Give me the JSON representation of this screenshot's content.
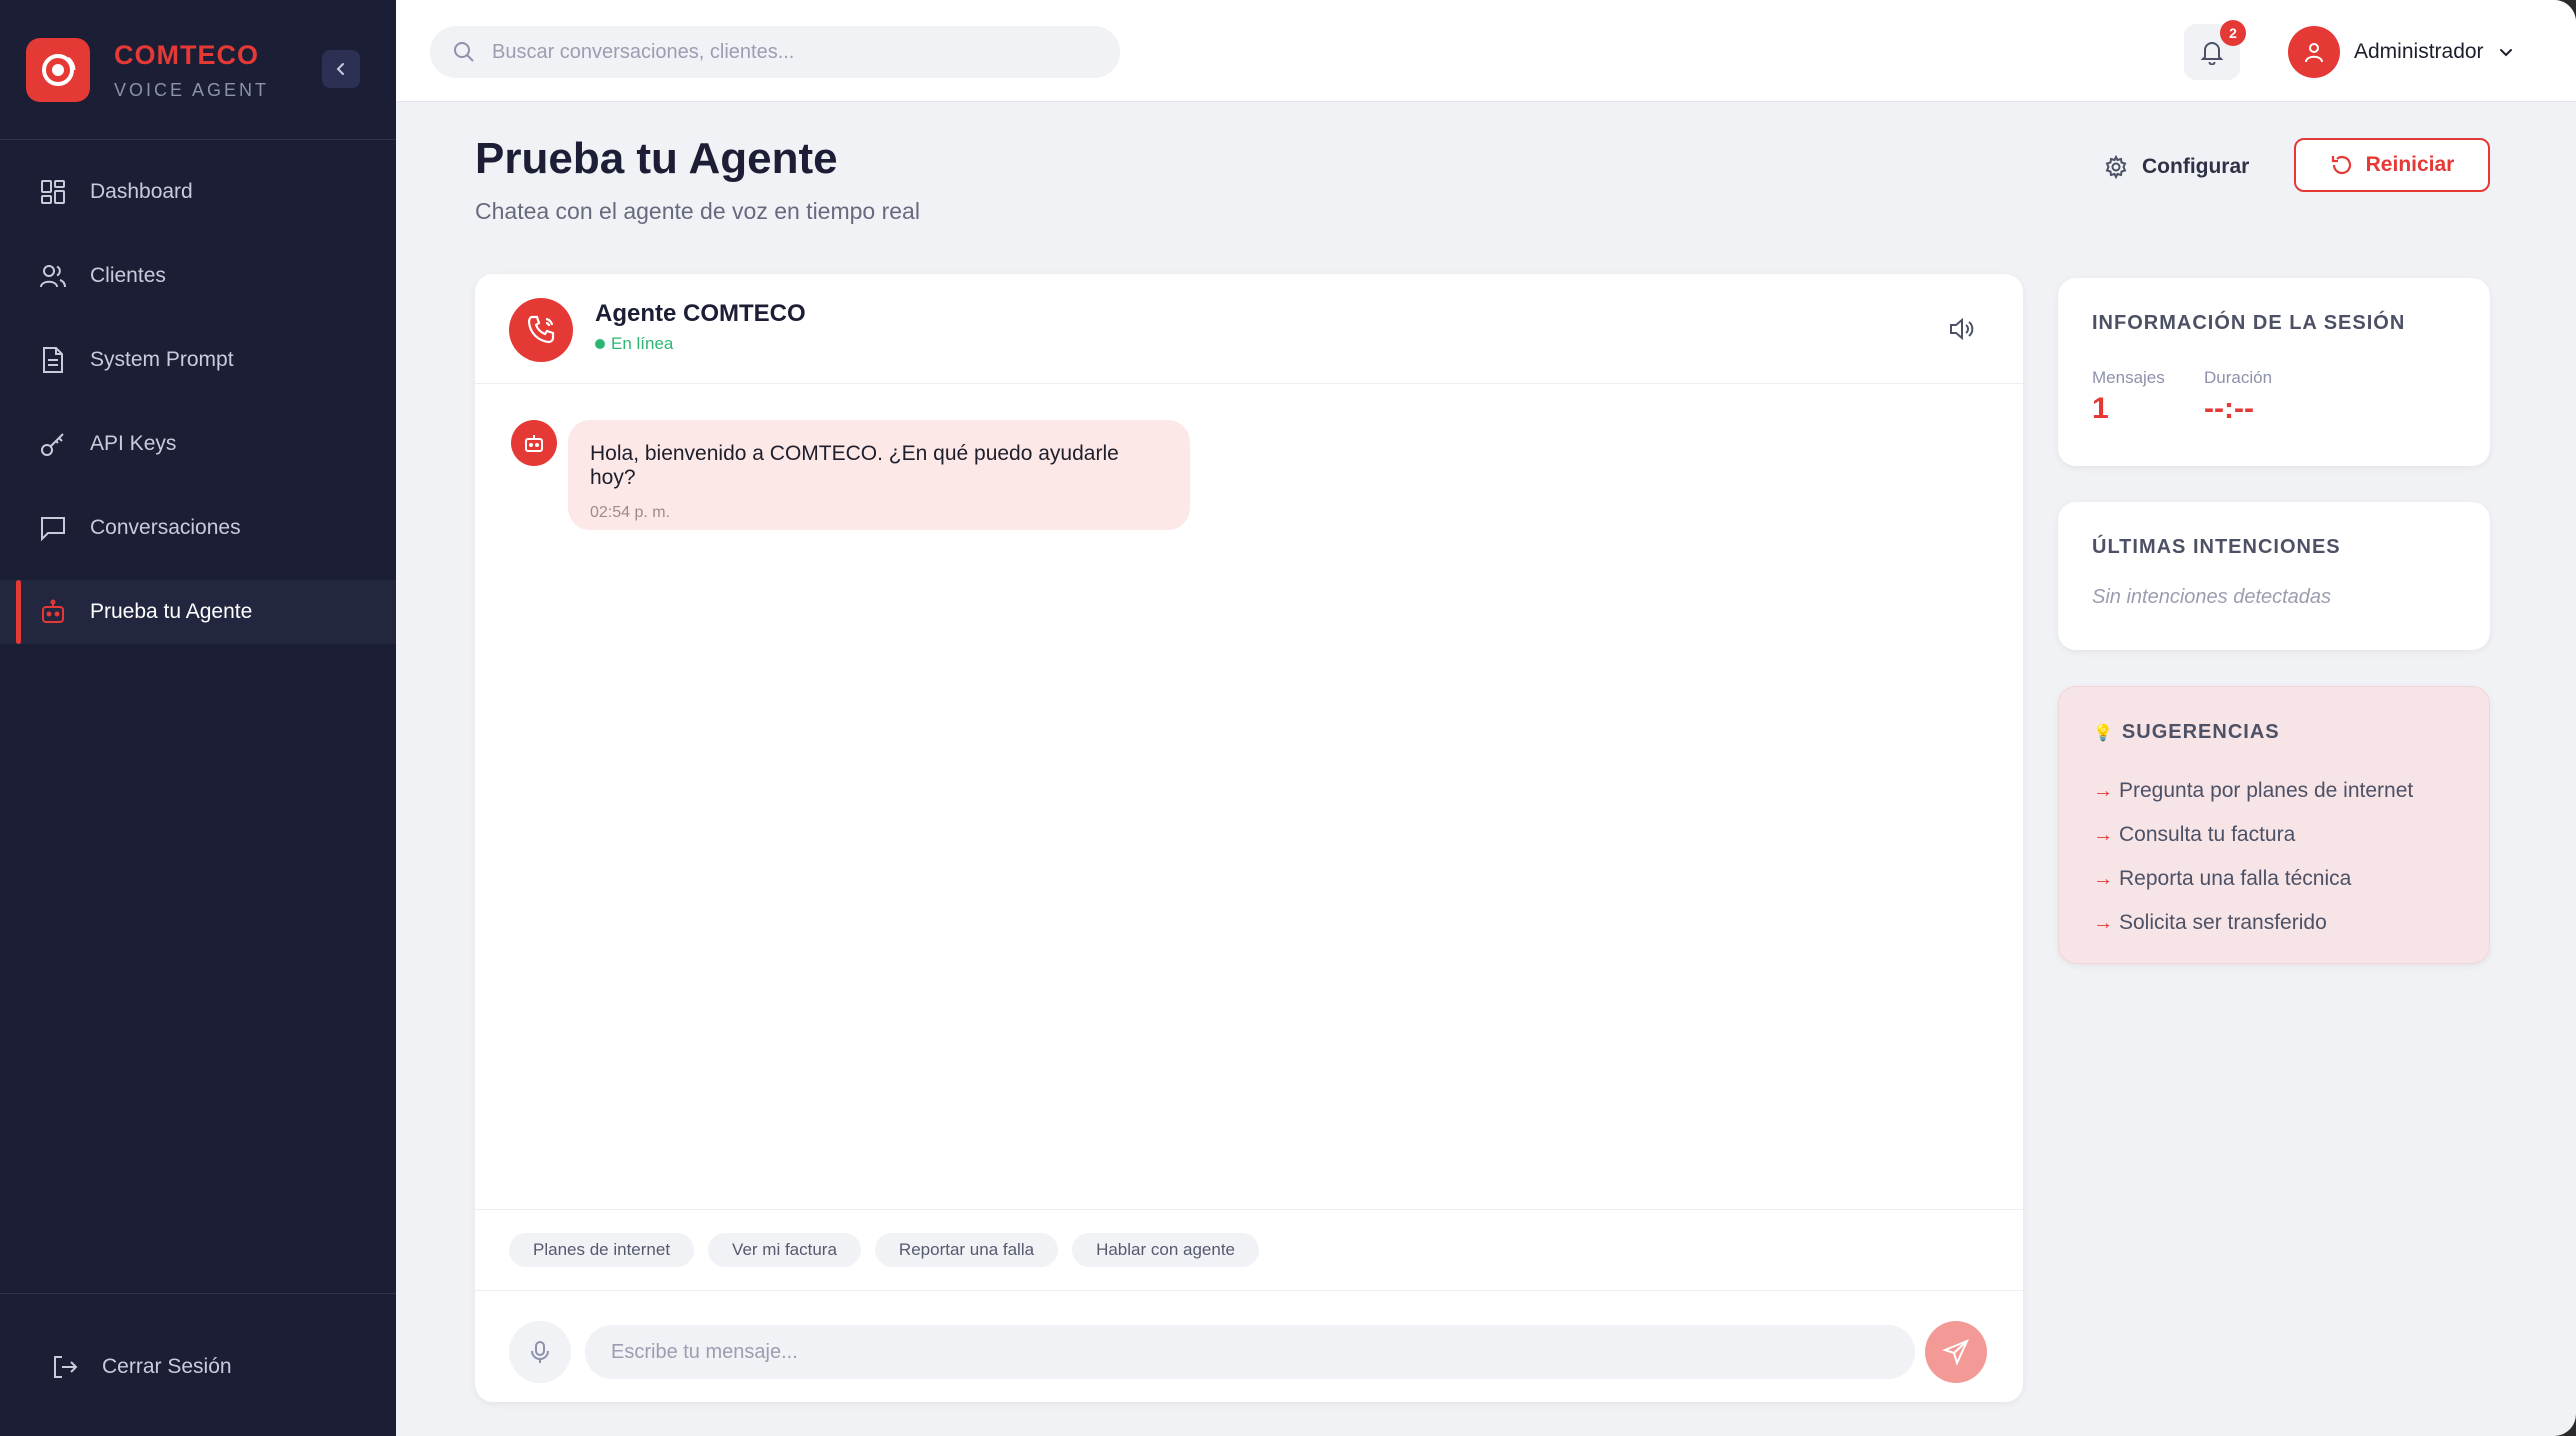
{
  "brand": {
    "title": "COMTECO",
    "subtitle": "VOICE AGENT",
    "color": "#e53936"
  },
  "sidebar": {
    "items": [
      {
        "label": "Dashboard",
        "icon": "dashboard-icon"
      },
      {
        "label": "Clientes",
        "icon": "users-icon"
      },
      {
        "label": "System Prompt",
        "icon": "document-icon"
      },
      {
        "label": "API Keys",
        "icon": "key-icon"
      },
      {
        "label": "Conversaciones",
        "icon": "chat-icon"
      },
      {
        "label": "Prueba tu Agente",
        "icon": "bot-icon",
        "active": true
      }
    ],
    "logout_label": "Cerrar Sesión"
  },
  "topbar": {
    "search_placeholder": "Buscar conversaciones, clientes...",
    "notification_count": "2",
    "user_name": "Administrador"
  },
  "page": {
    "title": "Prueba tu Agente",
    "subtitle": "Chatea con el agente de voz en tiempo real",
    "config_label": "Configurar",
    "reset_label": "Reiniciar"
  },
  "chat": {
    "agent_name": "Agente COMTECO",
    "status": "En línea",
    "messages": [
      {
        "text": "Hola, bienvenido a COMTECO. ¿En qué puedo ayudarle hoy?",
        "time": "02:54 p. m."
      }
    ],
    "quick_replies": [
      "Planes de internet",
      "Ver mi factura",
      "Reportar una falla",
      "Hablar con agente"
    ],
    "input_placeholder": "Escribe tu mensaje..."
  },
  "session_info": {
    "title": "INFORMACIÓN DE LA SESIÓN",
    "messages_label": "Mensajes",
    "messages_value": "1",
    "duration_label": "Duración",
    "duration_value": "--:--"
  },
  "intents": {
    "title": "ÚLTIMAS INTENCIONES",
    "empty_text": "Sin intenciones detectadas"
  },
  "suggestions": {
    "icon": "💡",
    "title": "SUGERENCIAS",
    "items": [
      "Pregunta por planes de internet",
      "Consulta tu factura",
      "Reporta una falla técnica",
      "Solicita ser transferido"
    ]
  }
}
